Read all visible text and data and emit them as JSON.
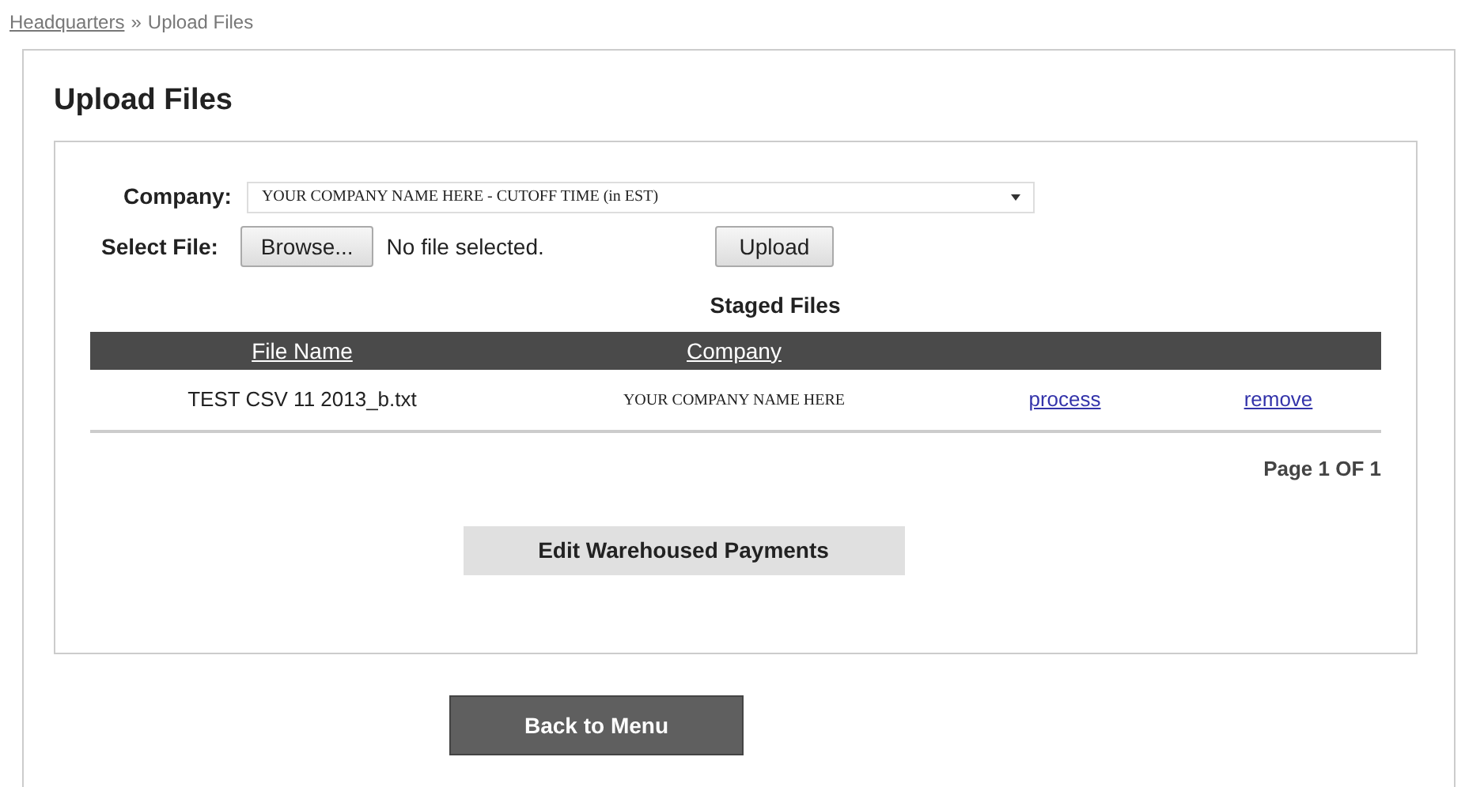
{
  "breadcrumb": {
    "link": "Headquarters",
    "separator": "»",
    "current": "Upload Files"
  },
  "title": "Upload Files",
  "company": {
    "label": "Company:",
    "value": "YOUR COMPANY NAME HERE - CUTOFF TIME (in EST)"
  },
  "file": {
    "label": "Select File:",
    "browse": "Browse...",
    "status": "No file selected.",
    "upload": "Upload"
  },
  "staged": {
    "title": "Staged Files",
    "columns": [
      "File Name",
      "Company"
    ],
    "rows": [
      {
        "file_name": "TEST CSV 11 2013_b.txt",
        "company": "YOUR COMPANY NAME HERE",
        "actions": [
          "process",
          "remove"
        ]
      }
    ],
    "pagination": "Page 1 OF 1"
  },
  "edit_button": "Edit Warehoused Payments",
  "back_button": "Back to Menu"
}
